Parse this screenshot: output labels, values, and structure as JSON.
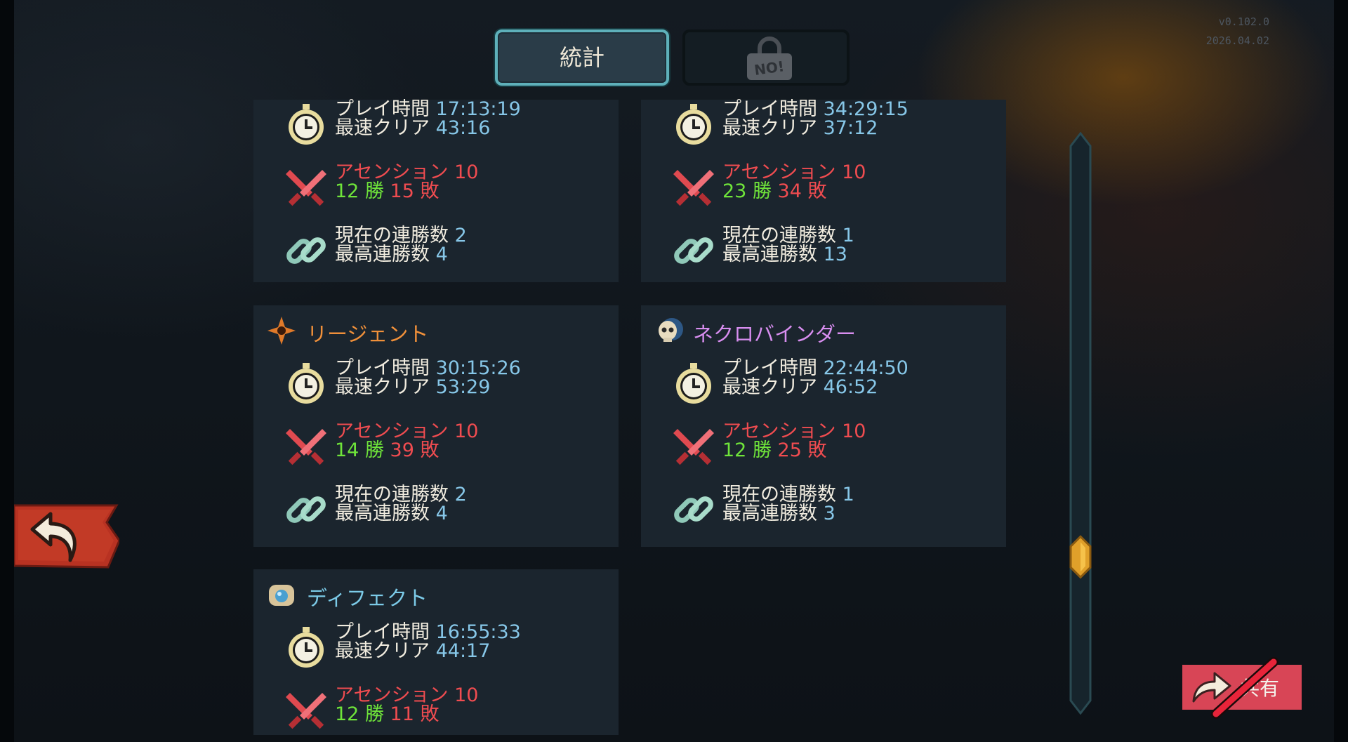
{
  "version": {
    "build": "v0.102.0",
    "date": "2026.04.02"
  },
  "tabs": {
    "stats": "統計",
    "locked_badge": "NO!"
  },
  "cards": [
    {
      "name": "",
      "play_time_label": "プレイ時間",
      "play_time": "17:13:19",
      "fastest_label": "最速クリア",
      "fastest": "43:16",
      "ascension_label": "アセンション",
      "ascension": "10",
      "wins": "12",
      "wins_label": "勝",
      "losses": "15",
      "losses_label": "敗",
      "streak_label": "現在の連勝数",
      "streak": "2",
      "best_streak_label": "最高連勝数",
      "best_streak": "4"
    },
    {
      "name": "",
      "play_time_label": "プレイ時間",
      "play_time": "34:29:15",
      "fastest_label": "最速クリア",
      "fastest": "37:12",
      "ascension_label": "アセンション",
      "ascension": "10",
      "wins": "23",
      "wins_label": "勝",
      "losses": "34",
      "losses_label": "敗",
      "streak_label": "現在の連勝数",
      "streak": "1",
      "best_streak_label": "最高連勝数",
      "best_streak": "13"
    },
    {
      "name": "リージェント",
      "name_color": "#f0903a",
      "icon": "regent-star-icon",
      "play_time_label": "プレイ時間",
      "play_time": "30:15:26",
      "fastest_label": "最速クリア",
      "fastest": "53:29",
      "ascension_label": "アセンション",
      "ascension": "10",
      "wins": "14",
      "wins_label": "勝",
      "losses": "39",
      "losses_label": "敗",
      "streak_label": "現在の連勝数",
      "streak": "2",
      "best_streak_label": "最高連勝数",
      "best_streak": "4"
    },
    {
      "name": "ネクロバインダー",
      "name_color": "#d88ef0",
      "icon": "necrobinder-skull-icon",
      "play_time_label": "プレイ時間",
      "play_time": "22:44:50",
      "fastest_label": "最速クリア",
      "fastest": "46:52",
      "ascension_label": "アセンション",
      "ascension": "10",
      "wins": "12",
      "wins_label": "勝",
      "losses": "25",
      "losses_label": "敗",
      "streak_label": "現在の連勝数",
      "streak": "1",
      "best_streak_label": "最高連勝数",
      "best_streak": "3"
    },
    {
      "name": "ディフェクト",
      "name_color": "#7ccbe8",
      "icon": "defect-orb-icon",
      "play_time_label": "プレイ時間",
      "play_time": "16:55:33",
      "fastest_label": "最速クリア",
      "fastest": "44:17",
      "ascension_label": "アセンション",
      "ascension": "10",
      "wins": "12",
      "wins_label": "勝",
      "losses": "11",
      "losses_label": "敗"
    }
  ],
  "scroll": {
    "position_fraction": 0.76
  },
  "share_button": {
    "label": "共有"
  },
  "colors": {
    "value_blue": "#87c7e8",
    "ascension_red": "#f04c50",
    "win_green": "#6fe43a",
    "accent_teal": "#5eb0ba",
    "share_red": "#d84556"
  }
}
